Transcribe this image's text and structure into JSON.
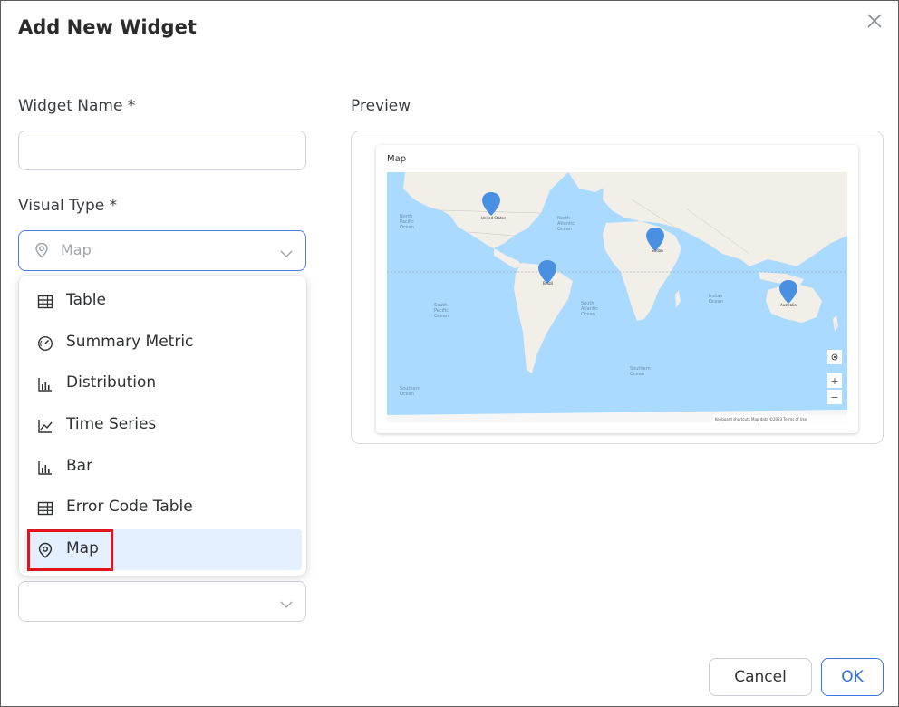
{
  "dialog": {
    "title": "Add New Widget",
    "close_icon": "close-icon"
  },
  "form": {
    "widget_name": {
      "label": "Widget Name *",
      "value": "",
      "placeholder": ""
    },
    "visual_type": {
      "label": "Visual Type *",
      "value": "Map",
      "icon": "map-pin-icon"
    },
    "lower_select": {
      "value": ""
    }
  },
  "dropdown": {
    "options": [
      {
        "label": "Table",
        "icon": "table-icon"
      },
      {
        "label": "Summary Metric",
        "icon": "gauge-icon"
      },
      {
        "label": "Distribution",
        "icon": "bar-chart-icon"
      },
      {
        "label": "Time Series",
        "icon": "line-chart-icon"
      },
      {
        "label": "Bar",
        "icon": "bar-chart-icon"
      },
      {
        "label": "Error Code Table",
        "icon": "table-icon"
      },
      {
        "label": "Map",
        "icon": "map-pin-icon",
        "selected": true
      }
    ]
  },
  "preview": {
    "label": "Preview",
    "card_title": "Map",
    "map": {
      "ocean_labels": [
        "North Pacific Ocean",
        "North Atlantic Ocean",
        "South Pacific Ocean",
        "South Atlantic Ocean",
        "Indian Ocean",
        "Southern Ocean"
      ],
      "markers": [
        "United States",
        "Brazil",
        "Sudan",
        "Australia"
      ],
      "attribution": "Keyboard shortcuts   Map data ©2023   Terms of Use",
      "zoom_in": "+",
      "zoom_out": "−"
    }
  },
  "actions": {
    "cancel_label": "Cancel",
    "ok_label": "OK"
  },
  "colors": {
    "accent": "#2d6de0",
    "selected_bg": "#e4efff",
    "highlight": "#e0141b",
    "map_water": "#aadaff",
    "map_land": "#f2efe9",
    "marker": "#4a90e2"
  }
}
